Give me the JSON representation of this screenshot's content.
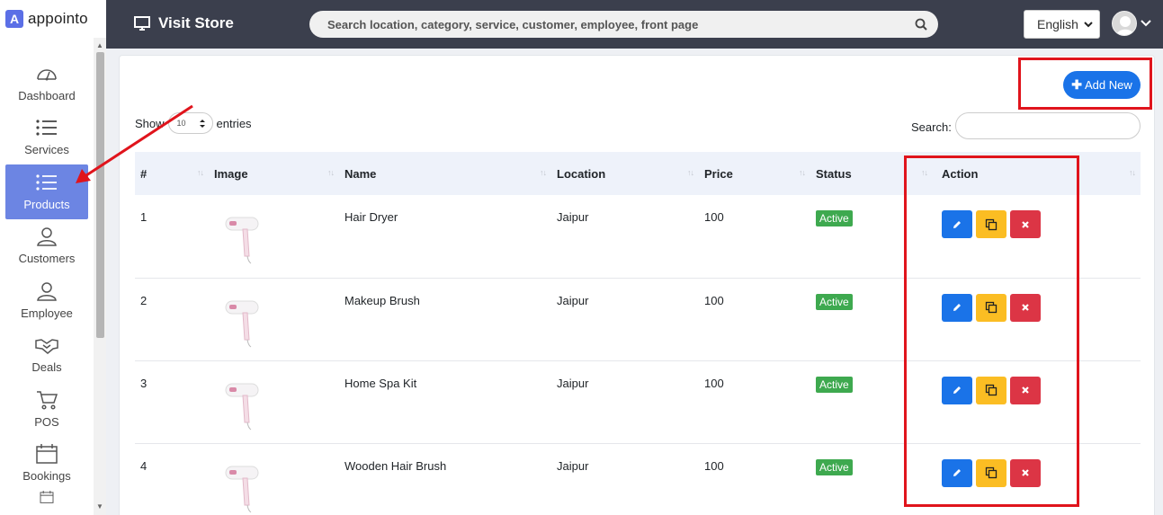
{
  "brand": {
    "logo_letter": "A",
    "name": "appointo"
  },
  "sidebar": {
    "items": [
      {
        "label": "Dashboard",
        "icon": "gauge-icon"
      },
      {
        "label": "Services",
        "icon": "list-icon"
      },
      {
        "label": "Products",
        "icon": "list-icon",
        "active": true
      },
      {
        "label": "Customers",
        "icon": "user-icon"
      },
      {
        "label": "Employee",
        "icon": "user-icon"
      },
      {
        "label": "Deals",
        "icon": "handshake-icon"
      },
      {
        "label": "POS",
        "icon": "cart-icon"
      },
      {
        "label": "Bookings",
        "icon": "calendar-icon"
      }
    ]
  },
  "topbar": {
    "visit_store": "Visit Store",
    "search_placeholder": "Search location, category, service, customer, employee, front page",
    "language": "English"
  },
  "content": {
    "add_new_label": "Add New",
    "show_label": "Show",
    "entries_value": "10",
    "entries_label": "entries",
    "search_label": "Search:",
    "columns": [
      "#",
      "Image",
      "Name",
      "Location",
      "Price",
      "Status",
      "Action"
    ],
    "rows": [
      {
        "num": "1",
        "name": "Hair Dryer",
        "location": "Jaipur",
        "price": "100",
        "status": "Active"
      },
      {
        "num": "2",
        "name": "Makeup Brush",
        "location": "Jaipur",
        "price": "100",
        "status": "Active"
      },
      {
        "num": "3",
        "name": "Home Spa Kit",
        "location": "Jaipur",
        "price": "100",
        "status": "Active"
      },
      {
        "num": "4",
        "name": "Wooden Hair Brush",
        "location": "Jaipur",
        "price": "100",
        "status": "Active"
      }
    ]
  },
  "colors": {
    "topbar": "#3b3f4d",
    "sidebar_active": "#6c85e3",
    "primary": "#1a73e8",
    "warning": "#fbbd23",
    "danger": "#dc3545",
    "success": "#3ea94f",
    "annotation": "#e0141c"
  }
}
